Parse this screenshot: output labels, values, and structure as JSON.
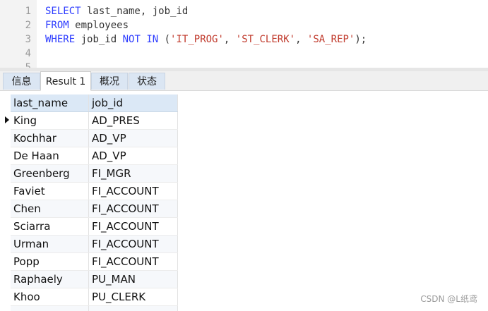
{
  "editor": {
    "lines": [
      {
        "num": "1",
        "tokens": [
          {
            "t": "SELECT",
            "c": "kw"
          },
          {
            "t": " last_name, job_id",
            "c": "plain"
          }
        ]
      },
      {
        "num": "2",
        "tokens": [
          {
            "t": "FROM",
            "c": "kw"
          },
          {
            "t": " employees",
            "c": "plain"
          }
        ]
      },
      {
        "num": "3",
        "tokens": [
          {
            "t": "WHERE",
            "c": "kw"
          },
          {
            "t": " job_id ",
            "c": "plain"
          },
          {
            "t": "NOT",
            "c": "kw"
          },
          {
            "t": " ",
            "c": "plain"
          },
          {
            "t": "IN",
            "c": "kw"
          },
          {
            "t": " (",
            "c": "plain"
          },
          {
            "t": "'IT_PROG'",
            "c": "str"
          },
          {
            "t": ", ",
            "c": "plain"
          },
          {
            "t": "'ST_CLERK'",
            "c": "str"
          },
          {
            "t": ", ",
            "c": "plain"
          },
          {
            "t": "'SA_REP'",
            "c": "str"
          },
          {
            "t": ");",
            "c": "plain"
          }
        ]
      },
      {
        "num": "4",
        "tokens": []
      },
      {
        "num": "5",
        "tokens": []
      }
    ]
  },
  "tabs": {
    "info": "信息",
    "result": "Result 1",
    "overview": "概况",
    "status": "状态"
  },
  "grid": {
    "columns": [
      "last_name",
      "job_id"
    ],
    "rows": [
      [
        "King",
        "AD_PRES"
      ],
      [
        "Kochhar",
        "AD_VP"
      ],
      [
        "De Haan",
        "AD_VP"
      ],
      [
        "Greenberg",
        "FI_MGR"
      ],
      [
        "Faviet",
        "FI_ACCOUNT"
      ],
      [
        "Chen",
        "FI_ACCOUNT"
      ],
      [
        "Sciarra",
        "FI_ACCOUNT"
      ],
      [
        "Urman",
        "FI_ACCOUNT"
      ],
      [
        "Popp",
        "FI_ACCOUNT"
      ],
      [
        "Raphaely",
        "PU_MAN"
      ],
      [
        "Khoo",
        "PU_CLERK"
      ],
      [
        "",
        ""
      ]
    ]
  },
  "watermark": "CSDN @L纸鸢"
}
